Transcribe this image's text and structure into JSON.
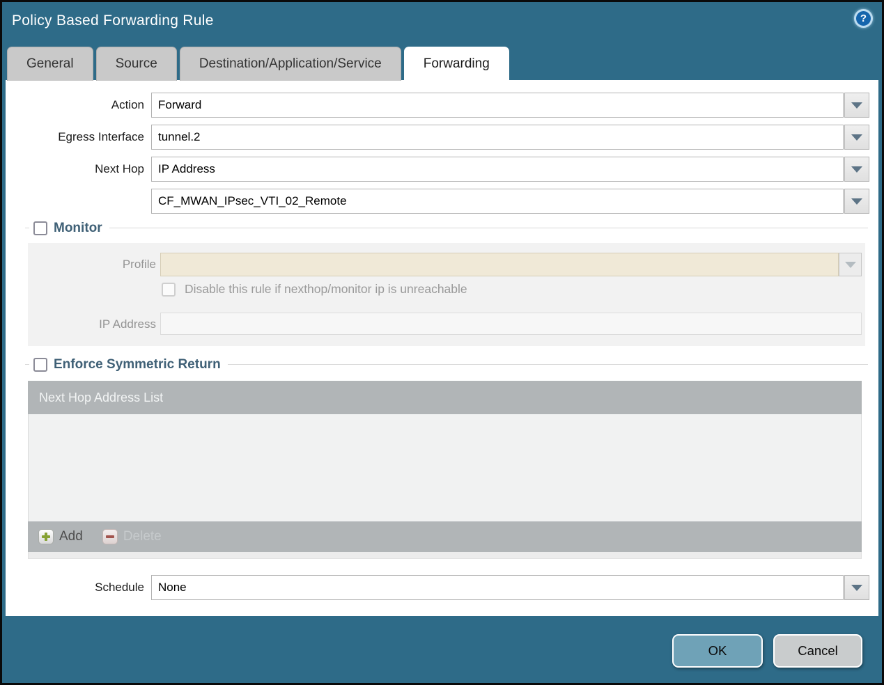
{
  "dialog": {
    "title": "Policy Based Forwarding Rule",
    "help_glyph": "?"
  },
  "tabs": [
    {
      "label": "General",
      "active": false
    },
    {
      "label": "Source",
      "active": false
    },
    {
      "label": "Destination/Application/Service",
      "active": false
    },
    {
      "label": "Forwarding",
      "active": true
    }
  ],
  "form": {
    "action": {
      "label": "Action",
      "value": "Forward"
    },
    "egress_interface": {
      "label": "Egress Interface",
      "value": "tunnel.2"
    },
    "next_hop": {
      "label": "Next Hop",
      "value": "IP Address"
    },
    "next_hop_address": {
      "value": "CF_MWAN_IPsec_VTI_02_Remote"
    },
    "monitor": {
      "legend": "Monitor",
      "checked": false,
      "profile": {
        "label": "Profile",
        "value": ""
      },
      "disable_rule": {
        "label": "Disable this rule if nexthop/monitor ip is unreachable",
        "checked": false
      },
      "ip_address": {
        "label": "IP Address",
        "value": ""
      }
    },
    "enforce_symmetric_return": {
      "legend": "Enforce Symmetric Return",
      "checked": false,
      "table": {
        "header": "Next Hop Address List",
        "rows": []
      },
      "add_button": "Add",
      "delete_button": "Delete"
    },
    "schedule": {
      "label": "Schedule",
      "value": "None"
    }
  },
  "buttons": {
    "ok": "OK",
    "cancel": "Cancel"
  },
  "colors": {
    "titlebar": "#2e6b88",
    "ok_button": "#6fa2b7",
    "cancel_button": "#c9cccd",
    "disabled_profile_field": "#f0e9d7",
    "table_chrome": "#b1b5b7",
    "section_title": "#3f6076",
    "active_tab": "#ffffff",
    "inactive_tab": "#c9c9c9"
  }
}
